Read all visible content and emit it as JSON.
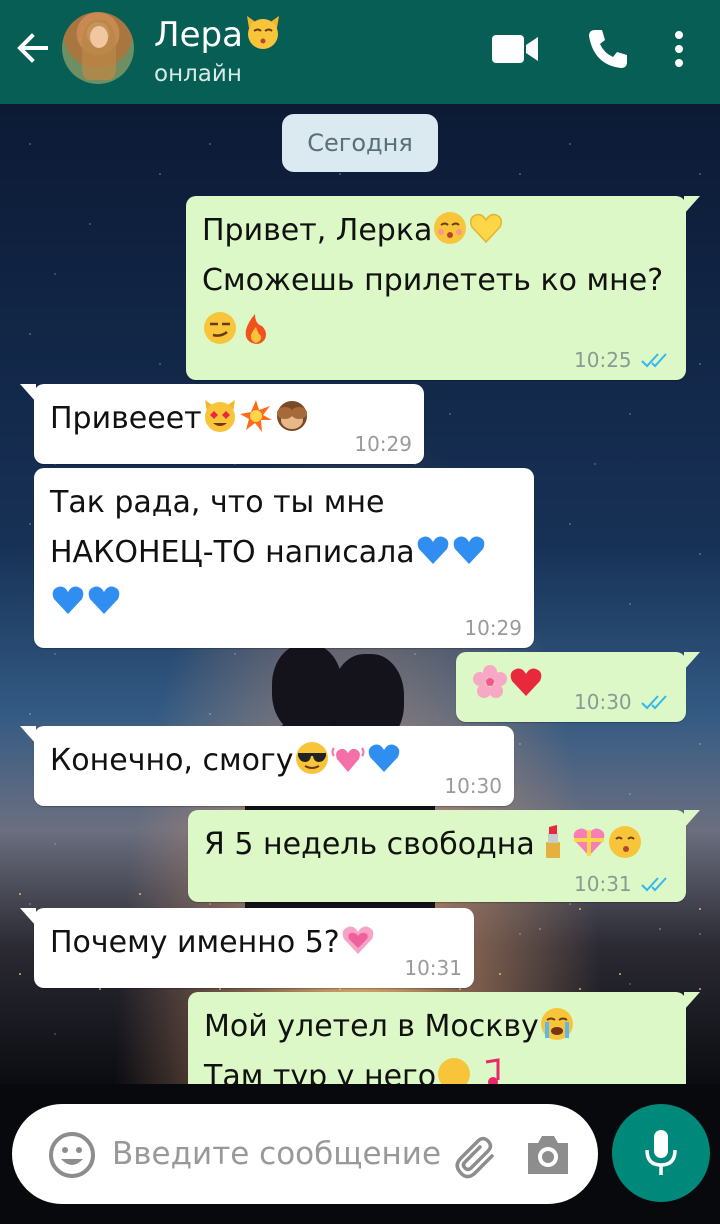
{
  "header": {
    "contact_name": "Лера",
    "status": "онлайн"
  },
  "chat": {
    "date_chip": "Сегодня",
    "messages": [
      {
        "dir": "out",
        "lines": [
          "Привет, Лерка",
          "Сможешь прилететь ко мне?",
          ""
        ],
        "time": "10:25",
        "read": true
      },
      {
        "dir": "in",
        "lines": [
          "Привееет"
        ],
        "time": "10:29"
      },
      {
        "dir": "in",
        "lines": [
          "Так рада, что ты мне",
          "НАКОНЕЦ-ТО написала",
          ""
        ],
        "time": "10:29"
      },
      {
        "dir": "out",
        "lines": [
          ""
        ],
        "time": "10:30",
        "read": true
      },
      {
        "dir": "in",
        "lines": [
          "Конечно, смогу"
        ],
        "time": "10:30"
      },
      {
        "dir": "out",
        "lines": [
          "Я 5 недель свободна"
        ],
        "time": "10:31",
        "read": true
      },
      {
        "dir": "in",
        "lines": [
          "Почему именно 5?"
        ],
        "time": "10:31"
      },
      {
        "dir": "out",
        "lines": [
          "Мой улетел в Москву",
          "Там тур у него"
        ],
        "time": "",
        "read": false
      }
    ]
  },
  "input": {
    "placeholder": "Введите сообщение"
  },
  "colors": {
    "header": "#075e54",
    "outgoing_bubble": "#dcf8c6",
    "incoming_bubble": "#ffffff",
    "mic_button": "#00897b",
    "read_ticks": "#34b7f1"
  },
  "icons": [
    "back-arrow-icon",
    "video-call-icon",
    "phone-call-icon",
    "more-menu-icon",
    "emoji-icon",
    "attach-icon",
    "camera-icon",
    "mic-icon"
  ]
}
